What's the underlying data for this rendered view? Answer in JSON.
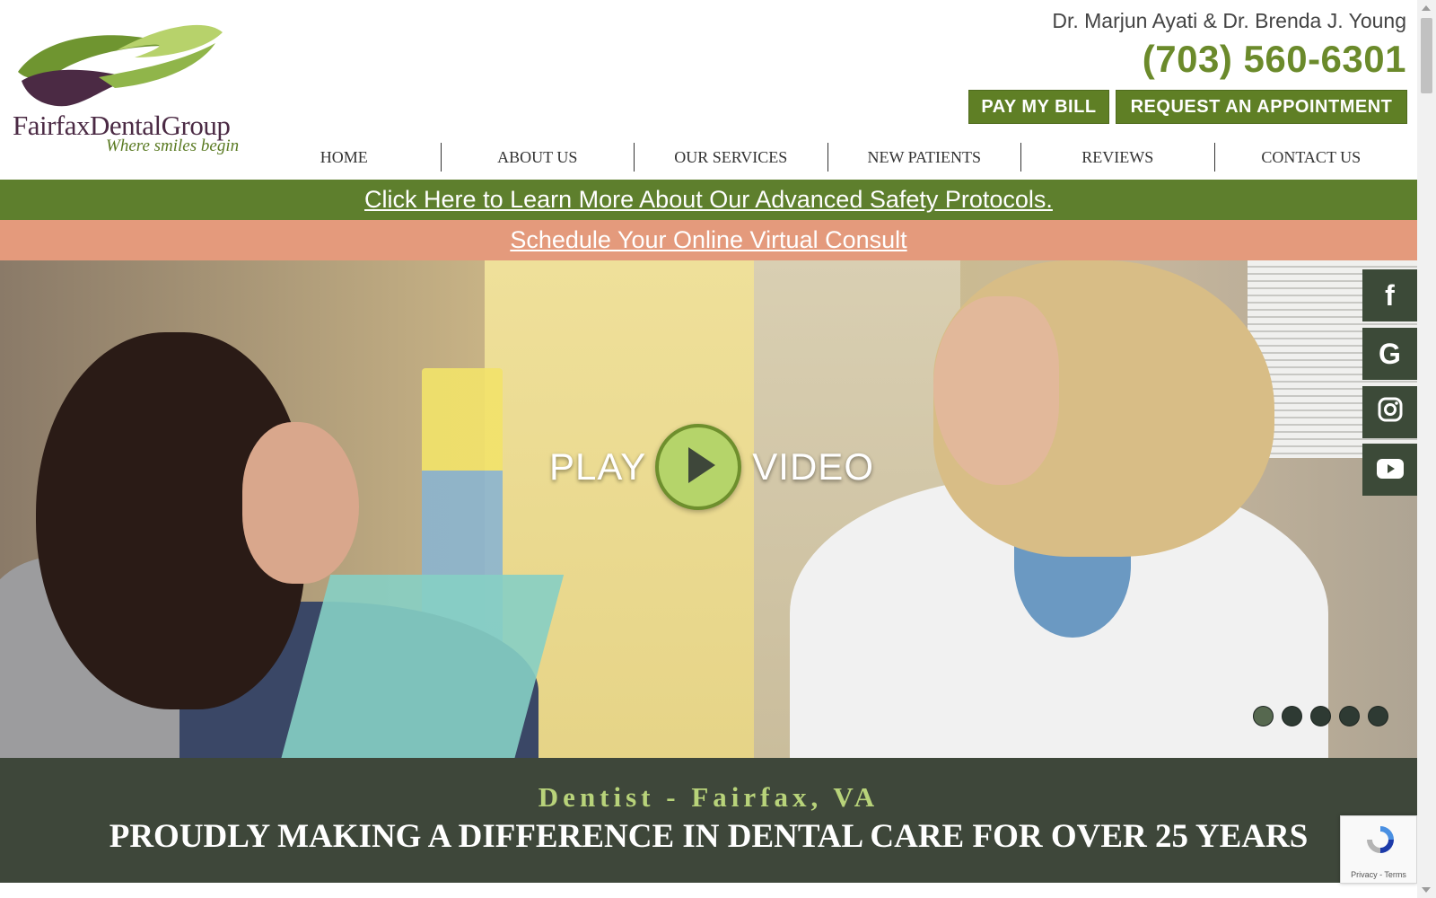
{
  "header": {
    "logo_name": "FairfaxDentalGroup",
    "logo_tagline": "Where smiles begin",
    "doctors": "Dr. Marjun Ayati & Dr. Brenda J. Young",
    "phone": "(703) 560-6301",
    "pay_bill_label": "PAY MY BILL",
    "appointment_label": "REQUEST AN APPOINTMENT"
  },
  "nav": {
    "items": [
      "HOME",
      "ABOUT US",
      "OUR SERVICES",
      "NEW PATIENTS",
      "REVIEWS",
      "CONTACT US"
    ]
  },
  "banners": {
    "safety": "Click Here to Learn More About Our Advanced Safety Protocols.",
    "consult": "Schedule Your Online Virtual Consult"
  },
  "hero": {
    "play_left": "PLAY",
    "play_right": "VIDEO",
    "slide_count": 5,
    "active_slide": 1
  },
  "social": {
    "facebook_glyph": "f",
    "google_glyph": "G",
    "icons": [
      "facebook-icon",
      "google-icon",
      "instagram-icon",
      "youtube-icon"
    ]
  },
  "tagline": {
    "subtitle": "Dentist - Fairfax, VA",
    "title": "PROUDLY MAKING A DIFFERENCE IN DENTAL CARE FOR OVER 25 YEARS"
  },
  "recaptcha": {
    "text": "Privacy - Terms"
  },
  "colors": {
    "brand_green": "#5f7f25",
    "phone_green": "#6b8a2b",
    "salmon": "#e49a7c",
    "dark_band": "#3e473a",
    "social_bg": "#3c4a38",
    "logo_purple": "#4b2a44"
  }
}
